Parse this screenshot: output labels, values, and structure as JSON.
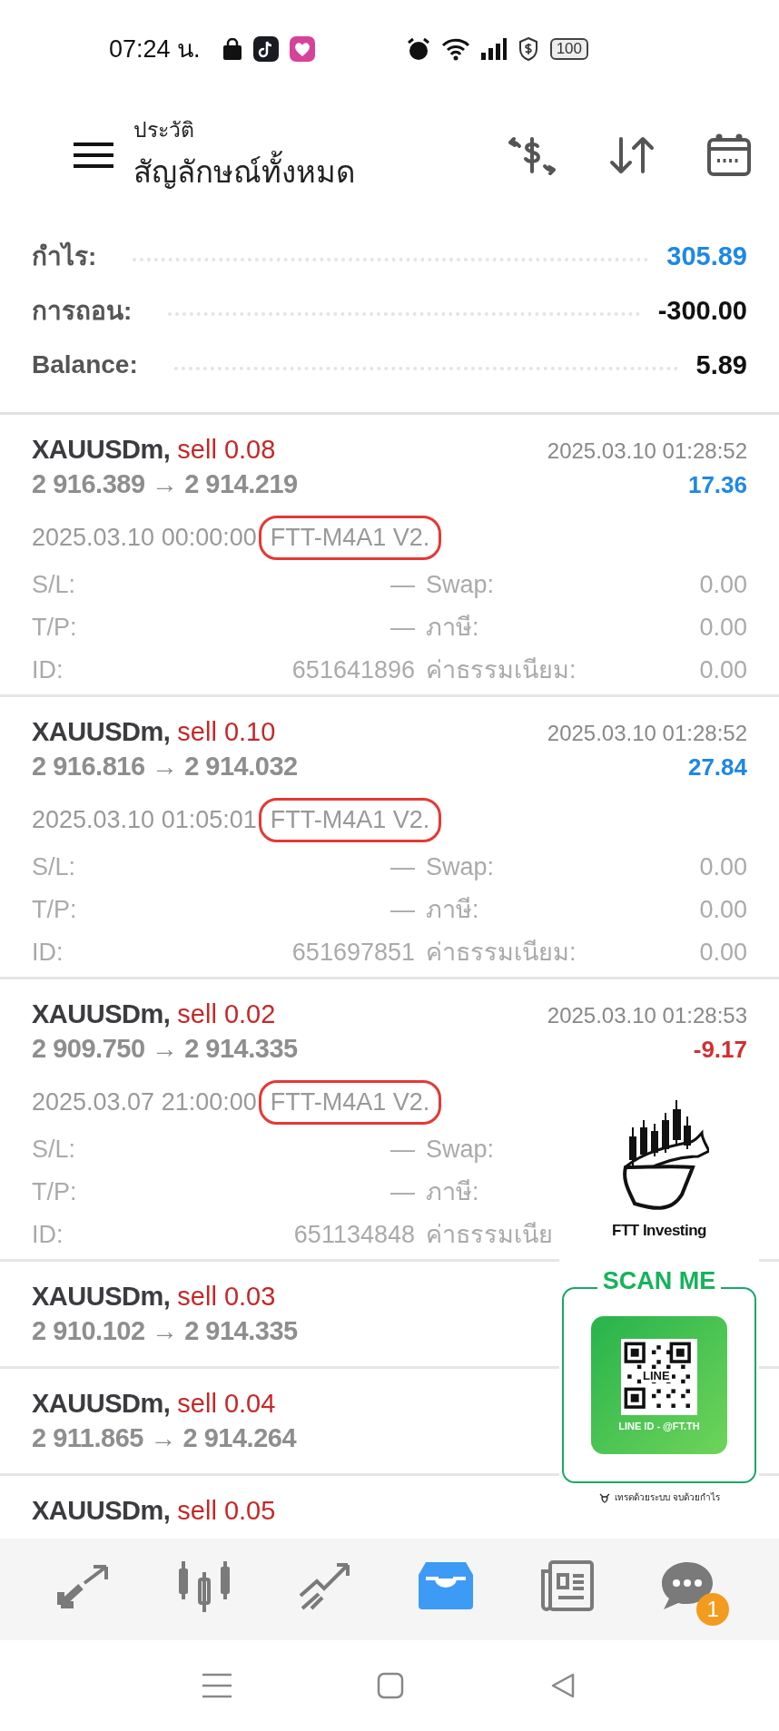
{
  "status_bar": {
    "time": "07:24 น.",
    "battery": "100"
  },
  "header": {
    "subtitle": "ประวัติ",
    "title": "สัญลักษณ์ทั้งหมด"
  },
  "summary": [
    {
      "label": "กำไร:",
      "value": "305.89",
      "color": "#1e88e5"
    },
    {
      "label": "การถอน:",
      "value": "-300.00",
      "color": "#111111"
    },
    {
      "label": "Balance:",
      "value": "5.89",
      "color": "#111111"
    }
  ],
  "trades": [
    {
      "symbol": "XAUUSDm,",
      "action": "sell 0.08",
      "close_time": "2025.03.10 01:28:52",
      "prices": "2 916.389 → 2 914.219",
      "profit": "17.36",
      "color": "#1e88e5",
      "open_time": "2025.03.10 00:00:00",
      "comment": "FTT-M4A1 V2.",
      "highlighted": true,
      "details": [
        {
          "label": "S/L:",
          "value": "—",
          "label2": "Swap:",
          "value2": "0.00"
        },
        {
          "label": "T/P:",
          "value": "—",
          "label2": "ภาษี:",
          "value2": "0.00"
        },
        {
          "label": "ID:",
          "value": "651641896",
          "label2": "ค่าธรรมเนียม:",
          "value2": "0.00"
        }
      ]
    },
    {
      "symbol": "XAUUSDm,",
      "action": "sell 0.10",
      "close_time": "2025.03.10 01:28:52",
      "prices": "2 916.816 → 2 914.032",
      "profit": "27.84",
      "color": "#1e88e5",
      "open_time": "2025.03.10 01:05:01",
      "comment": "FTT-M4A1 V2.",
      "highlighted": true,
      "details": [
        {
          "label": "S/L:",
          "value": "—",
          "label2": "Swap:",
          "value2": "0.00"
        },
        {
          "label": "T/P:",
          "value": "—",
          "label2": "ภาษี:",
          "value2": "0.00"
        },
        {
          "label": "ID:",
          "value": "651697851",
          "label2": "ค่าธรรมเนียม:",
          "value2": "0.00"
        }
      ]
    },
    {
      "symbol": "XAUUSDm,",
      "action": "sell 0.02",
      "close_time": "2025.03.10 01:28:53",
      "prices": "2 909.750 → 2 914.335",
      "profit": "-9.17",
      "color": "#d32f2f",
      "open_time": "2025.03.07 21:00:00",
      "comment": "FTT-M4A1 V2.",
      "highlighted": true,
      "details": [
        {
          "label": "S/L:",
          "value": "—",
          "label2": "Swap:"
        },
        {
          "label": "T/P:",
          "value": "—",
          "label2": "ภาษี:"
        },
        {
          "label": "ID:",
          "value": "651134848",
          "label2": "ค่าธรรมเนีย"
        }
      ]
    },
    {
      "symbol": "XAUUSDm,",
      "action": "sell 0.03",
      "prices": "2 910.102 → 2 914.335"
    },
    {
      "symbol": "XAUUSDm,",
      "action": "sell 0.04",
      "prices": "2 911.865 → 2 914.264"
    },
    {
      "symbol": "XAUUSDm,",
      "action": "sell 0.05"
    }
  ],
  "bottom_nav": [
    {
      "kind": "trade",
      "selected": false
    },
    {
      "kind": "quotes",
      "selected": false
    },
    {
      "kind": "chart",
      "selected": false
    },
    {
      "kind": "history",
      "selected": true
    },
    {
      "kind": "news",
      "selected": false
    },
    {
      "kind": "chat",
      "selected": false,
      "badge": "1"
    }
  ],
  "promo": {
    "brand": "FTT Investing",
    "heading": "SCAN ME",
    "qr_label": "LINE",
    "line_id": "LINE ID - @FT.TH",
    "tagline": "เทรดด้วยระบบ จบด้วยกำไร"
  }
}
